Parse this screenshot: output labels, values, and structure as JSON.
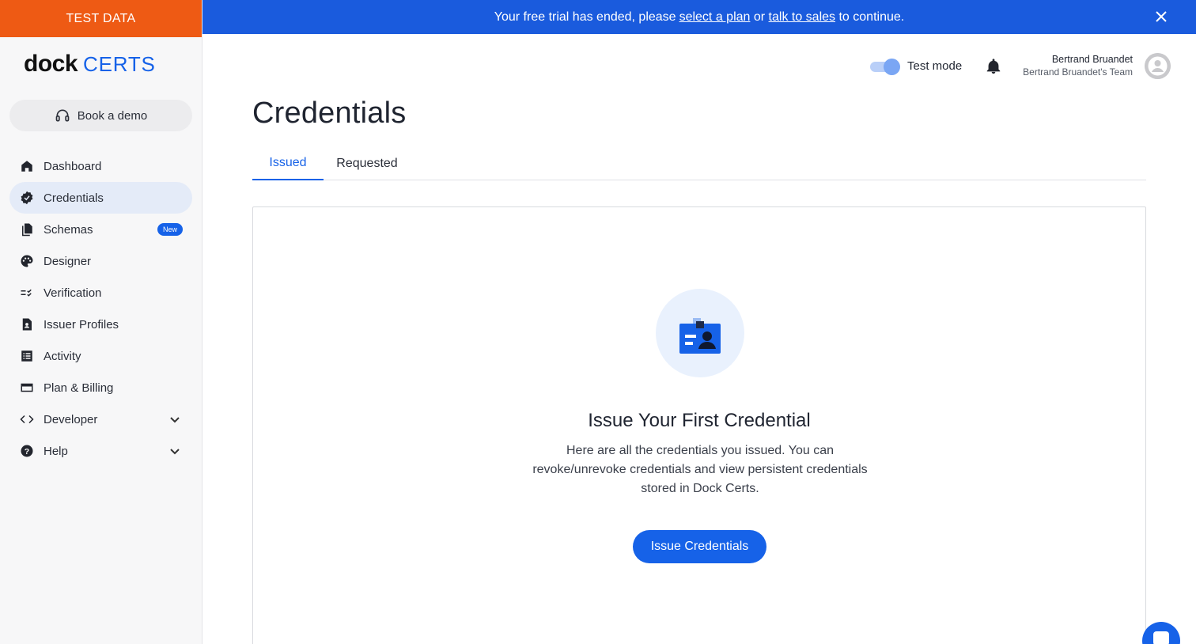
{
  "sidebar": {
    "test_data_label": "TEST DATA",
    "logo": {
      "dock": "dock",
      "certs": "CERTS"
    },
    "demo_button_label": "Book a demo",
    "items": [
      {
        "label": "Dashboard",
        "icon": "home-icon"
      },
      {
        "label": "Credentials",
        "icon": "verified-badge-icon",
        "active": true
      },
      {
        "label": "Schemas",
        "icon": "documents-icon",
        "badge": "New"
      },
      {
        "label": "Designer",
        "icon": "palette-icon"
      },
      {
        "label": "Verification",
        "icon": "checklist-icon"
      },
      {
        "label": "Issuer Profiles",
        "icon": "profile-document-icon"
      },
      {
        "label": "Activity",
        "icon": "list-icon"
      },
      {
        "label": "Plan & Billing",
        "icon": "card-icon"
      },
      {
        "label": "Developer",
        "icon": "code-icon",
        "expandable": true
      },
      {
        "label": "Help",
        "icon": "help-icon",
        "expandable": true
      }
    ]
  },
  "banner": {
    "text_before": "Your free trial has ended, please ",
    "link1": "select a plan",
    "text_middle": " or ",
    "link2": "talk to sales",
    "text_after": " to continue."
  },
  "topbar": {
    "test_mode_label": "Test mode",
    "test_mode_on": true,
    "user_name": "Bertrand Bruandet",
    "team_name": "Bertrand Bruandet's Team"
  },
  "main": {
    "title": "Credentials",
    "tabs": [
      {
        "label": "Issued",
        "active": true
      },
      {
        "label": "Requested",
        "active": false
      }
    ],
    "empty_state": {
      "title": "Issue Your First Credential",
      "description": "Here are all the credentials you issued. You can revoke/unrevoke credentials and view persistent credentials stored in Dock Certs.",
      "button_label": "Issue Credentials"
    }
  },
  "colors": {
    "brand_blue": "#1662e8",
    "test_data_orange": "#ee5a14",
    "banner_blue": "#1a5bdd"
  }
}
